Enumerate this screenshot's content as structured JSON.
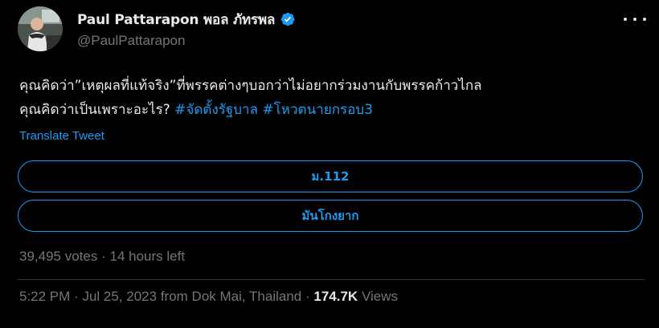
{
  "author": {
    "display_name": "Paul Pattarapon พอล ภัทรพล",
    "handle": "@PaulPattarapon",
    "verified_icon": "verified-badge-icon",
    "avatar_icon": "avatar"
  },
  "tweet": {
    "line1": "คุณคิดว่า”เหตุผลที่แท้จริง”ที่พรรคต่างๆบอกว่าไม่อยากร่วมงานกับพรรคก้าวไกล",
    "line2_text": "คุณคิดว่าเป็นเพราะอะไร? ",
    "hashtag1": "#จัดตั้งรัฐบาล",
    "hashtag2": "#โหวตนายกรอบ3",
    "translate_label": "Translate Tweet"
  },
  "poll": {
    "options": [
      "ม.112",
      "มันโกงยาก"
    ],
    "votes": "39,495 votes",
    "separator": "·",
    "time_left": "14 hours left"
  },
  "meta": {
    "time": "5:22 PM",
    "separator": "·",
    "date": "Jul 25, 2023",
    "source": "from Dok Mai, Thailand",
    "views_count": "174.7K",
    "views_label": "Views"
  },
  "colors": {
    "background": "#000000",
    "text": "#e7e9ea",
    "secondary": "#71767b",
    "accent": "#1d9bf0"
  }
}
